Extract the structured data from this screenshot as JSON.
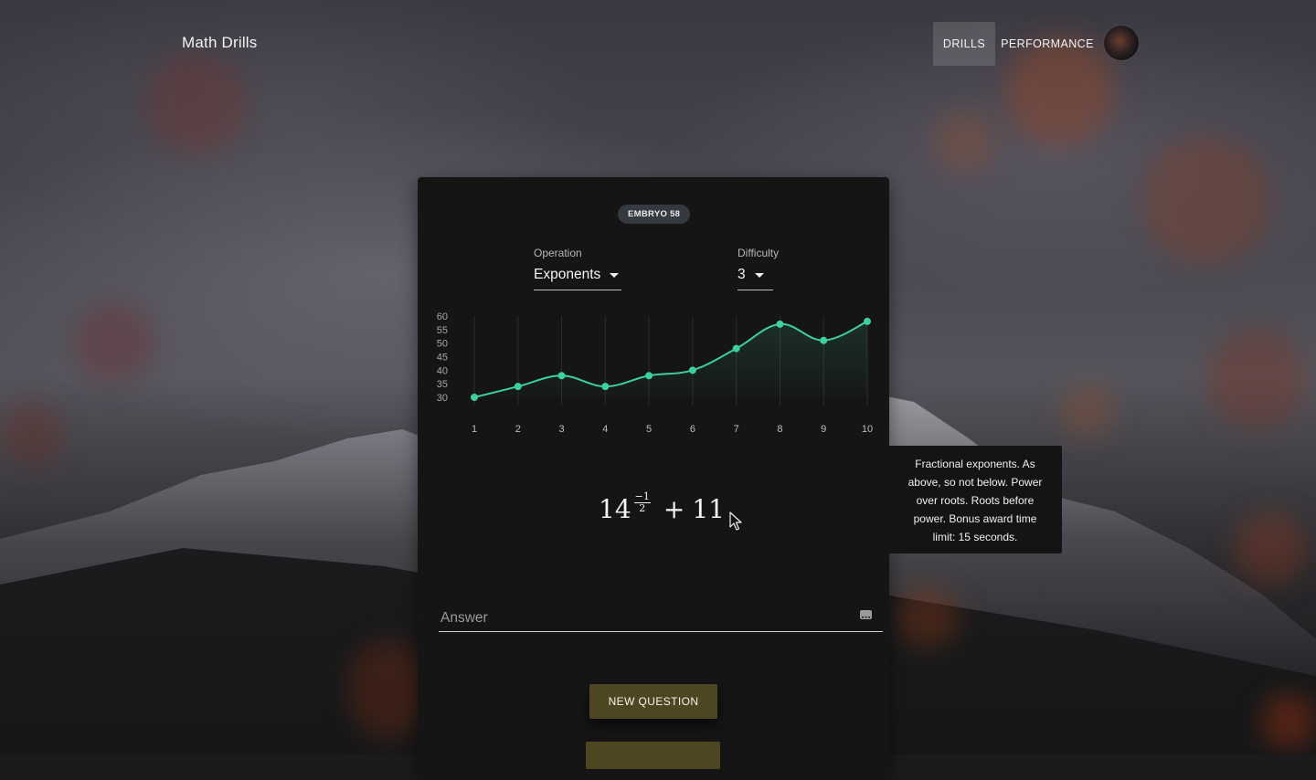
{
  "app": {
    "title": "Math Drills"
  },
  "nav": {
    "items": [
      {
        "label": "DRILLS",
        "active": true
      },
      {
        "label": "PERFORMANCE",
        "active": false
      }
    ]
  },
  "card": {
    "badge": "EMBRYO 58",
    "operation": {
      "label": "Operation",
      "value": "Exponents"
    },
    "difficulty": {
      "label": "Difficulty",
      "value": "3"
    },
    "equation": {
      "base": "14",
      "exponent_numerator": "−1",
      "exponent_denominator": "2",
      "operator": "+",
      "addend": "11"
    },
    "answer": {
      "placeholder": "Answer",
      "value": ""
    },
    "new_question_label": "NEW QUESTION"
  },
  "tooltip": {
    "text": "Fractional exponents. As above, so not below. Power over roots. Roots before power. Bonus award time limit: 15 seconds."
  },
  "colors": {
    "accent_line": "#3ecf9e",
    "button": "#4d4620",
    "card": "#151515",
    "chip": "#353a40"
  },
  "icons": {
    "keyboard": "keyboard-icon",
    "cursor": "mouse-pointer-icon"
  },
  "chart_data": {
    "type": "area",
    "x": [
      1,
      2,
      3,
      4,
      5,
      6,
      7,
      8,
      9,
      10
    ],
    "series": [
      {
        "values": [
          30,
          34,
          38,
          34,
          38,
          40,
          48,
          57,
          51,
          58
        ]
      }
    ],
    "y_ticks": [
      30,
      35,
      40,
      45,
      50,
      55,
      60
    ],
    "ylim": [
      30,
      60
    ],
    "grid": "vertical",
    "title": "",
    "xlabel": "",
    "ylabel": ""
  }
}
